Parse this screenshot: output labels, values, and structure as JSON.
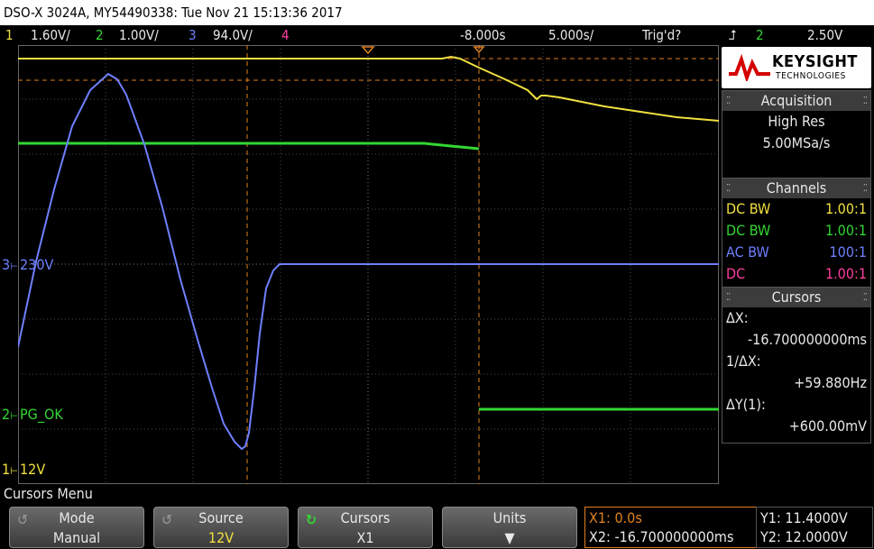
{
  "title": "DSO-X 3024A, MY54490338: Tue Nov 21 15:13:36 2017",
  "channel_bar": {
    "ch1_num": "1",
    "ch1_scale": "1.60V/",
    "ch2_num": "2",
    "ch2_scale": "1.00V/",
    "ch3_num": "3",
    "ch3_scale": "94.0V/",
    "ch4_num": "4",
    "time_offset": "-8.000s",
    "time_scale": "5.000s/",
    "trigger_status": "Trig'd?",
    "trigger_icon": "trigger-edge-icon",
    "trigger_source": "2",
    "trigger_level": "2.50V"
  },
  "waveform_labels": {
    "ch3": "230V",
    "ch2": "PG_OK",
    "ch1": "12V"
  },
  "logo": {
    "brand": "KEYSIGHT",
    "sub": "TECHNOLOGIES"
  },
  "acquisition": {
    "header": "Acquisition",
    "mode": "High Res",
    "rate": "5.00MSa/s"
  },
  "channels": {
    "header": "Channels",
    "rows": [
      {
        "coupling": "DC BW",
        "probe": "1.00:1",
        "color": "#f0e040"
      },
      {
        "coupling": "DC BW",
        "probe": "1.00:1",
        "color": "#33d633"
      },
      {
        "coupling": "AC BW",
        "probe": "100:1",
        "color": "#6f7fff"
      },
      {
        "coupling": "DC",
        "probe": "1.00:1",
        "color": "#ff3fa0"
      }
    ]
  },
  "cursors": {
    "header": "Cursors",
    "dx_label": "ΔX:",
    "dx_value": "-16.700000000ms",
    "inv_dx_label": "1/ΔX:",
    "inv_dx_value": "+59.880Hz",
    "dy_label": "ΔY(1):",
    "dy_value": "+600.00mV"
  },
  "menu": {
    "title": "Cursors Menu",
    "softkeys": [
      {
        "label": "Mode",
        "value": "Manual"
      },
      {
        "label": "Source",
        "value": "12V"
      },
      {
        "label": "Cursors",
        "value": "X1"
      },
      {
        "label": "Units",
        "value": ""
      }
    ],
    "x1": "X1: 0.0s",
    "x2": "X2: -16.700000000ms",
    "y1": "Y1: 11.4000V",
    "y2": "Y2: 12.0000V"
  },
  "colors": {
    "ch1": "#f0e040",
    "ch2": "#33d633",
    "ch3": "#6f7fff",
    "ch4": "#ff3fa0",
    "cursor": "#e08020"
  }
}
